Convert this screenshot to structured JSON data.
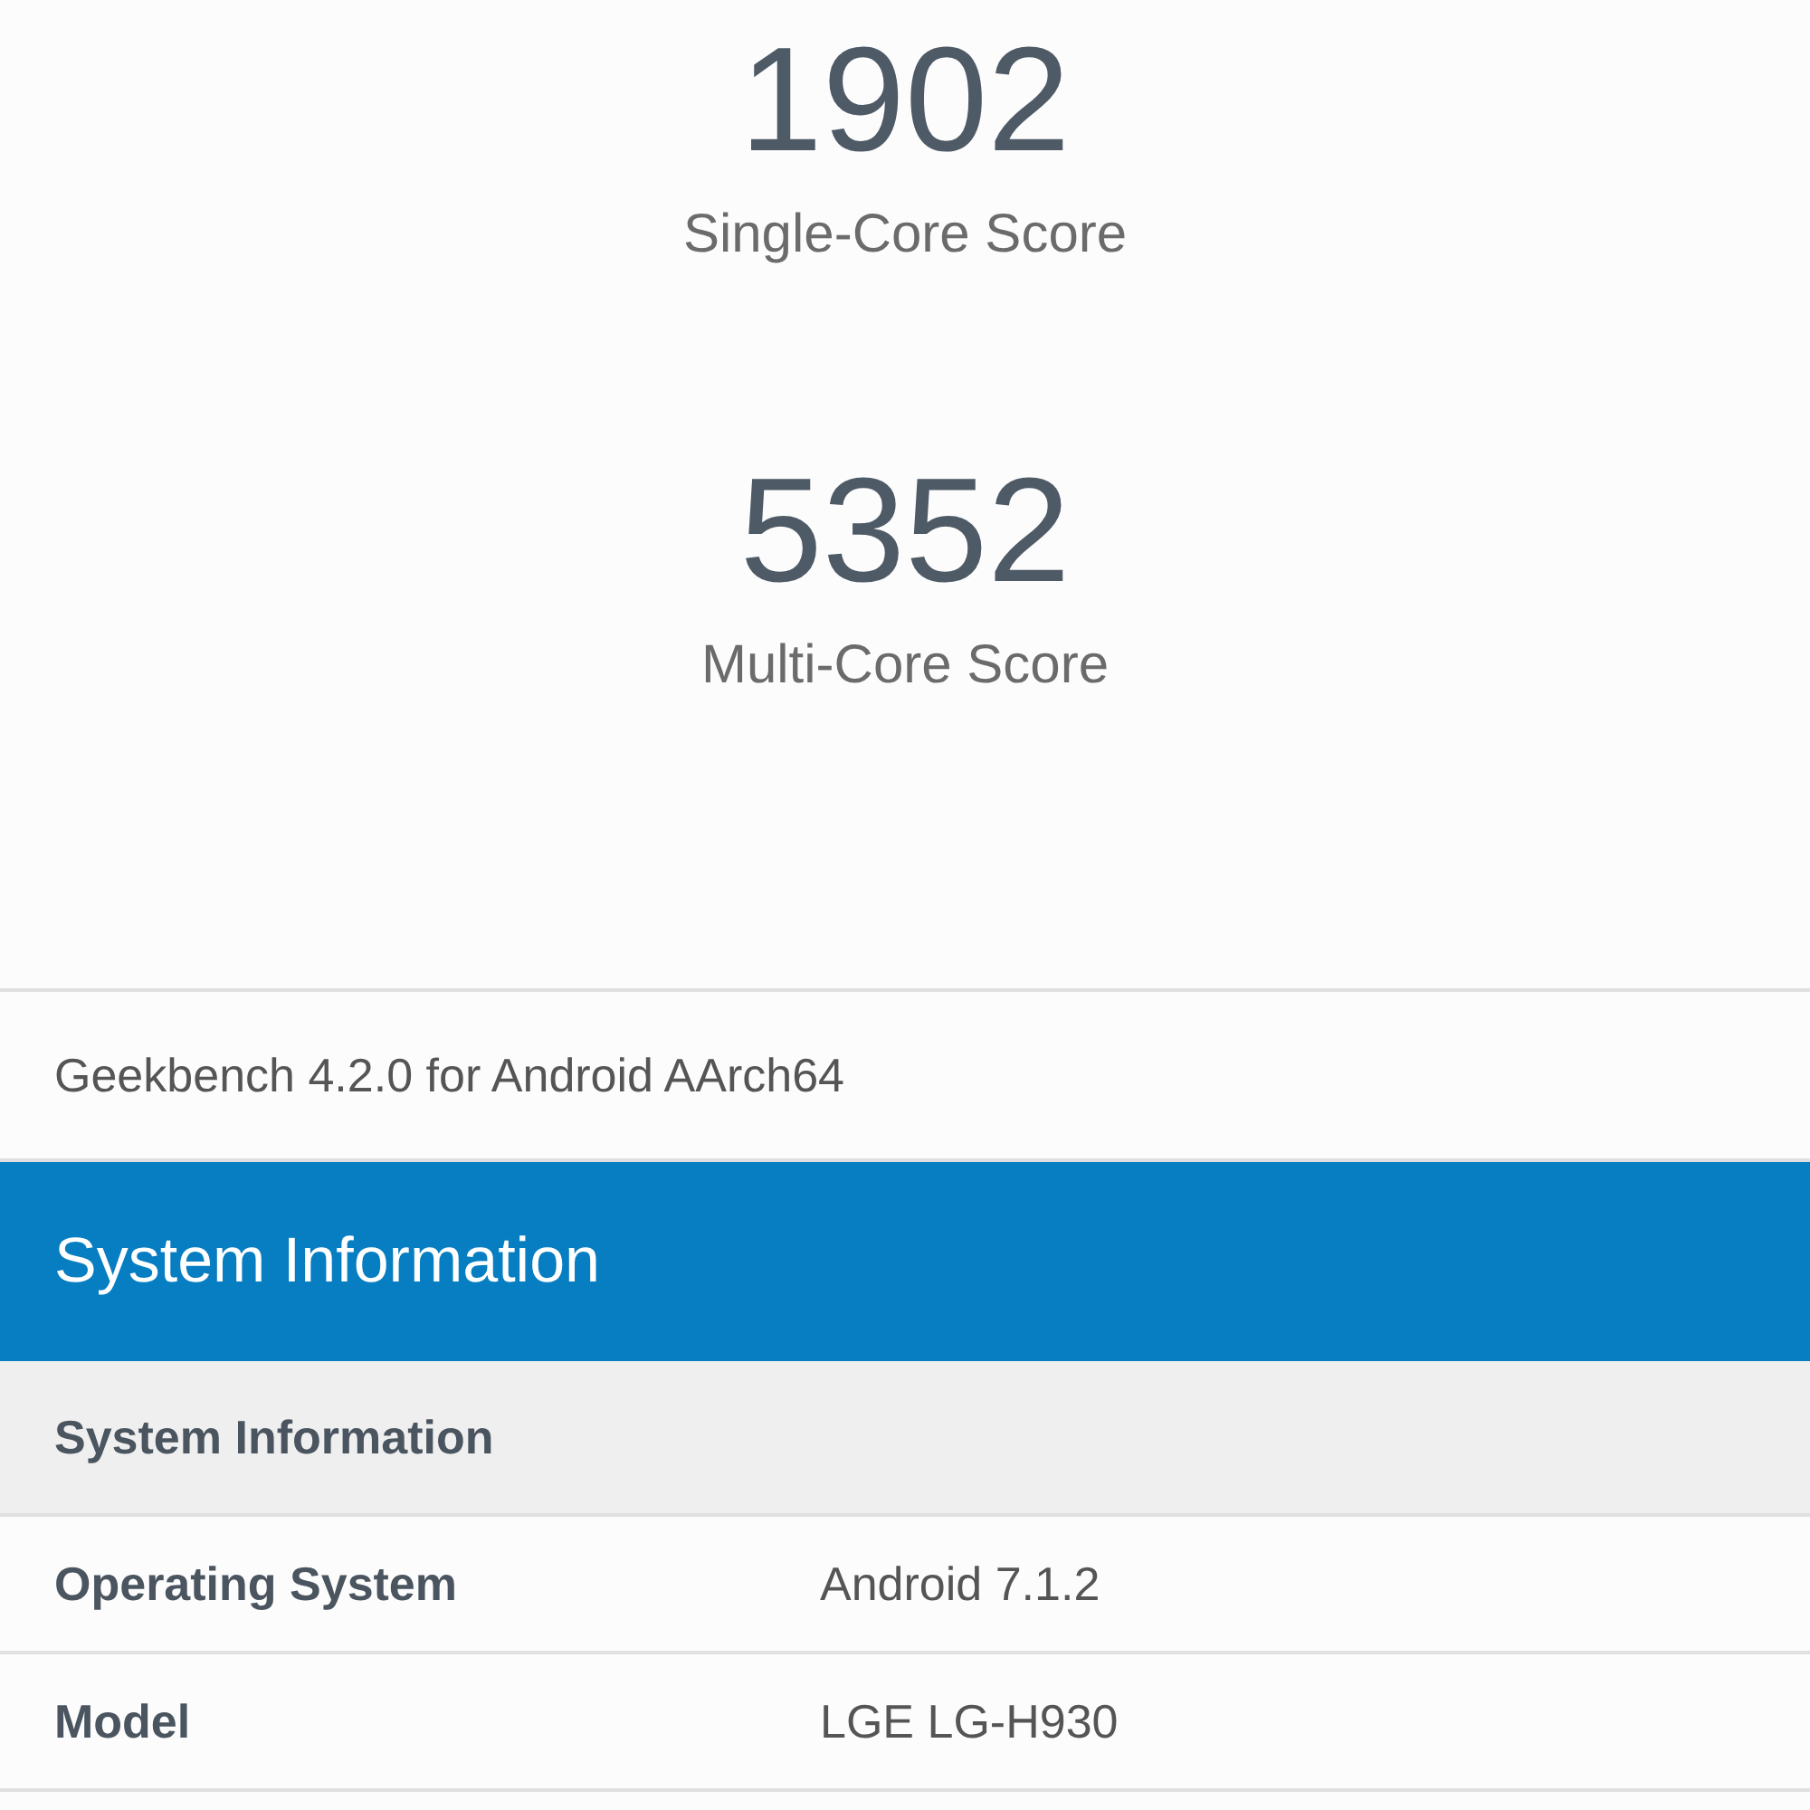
{
  "scores": [
    {
      "value": "1902",
      "label": "Single-Core Score"
    },
    {
      "value": "5352",
      "label": "Multi-Core Score"
    }
  ],
  "version": "Geekbench 4.2.0 for Android AArch64",
  "section": {
    "title": "System Information",
    "table_header": "System Information",
    "rows": [
      {
        "name": "Operating System",
        "value": "Android 7.1.2"
      },
      {
        "name": "Model",
        "value": "LGE LG-H930"
      }
    ]
  }
}
